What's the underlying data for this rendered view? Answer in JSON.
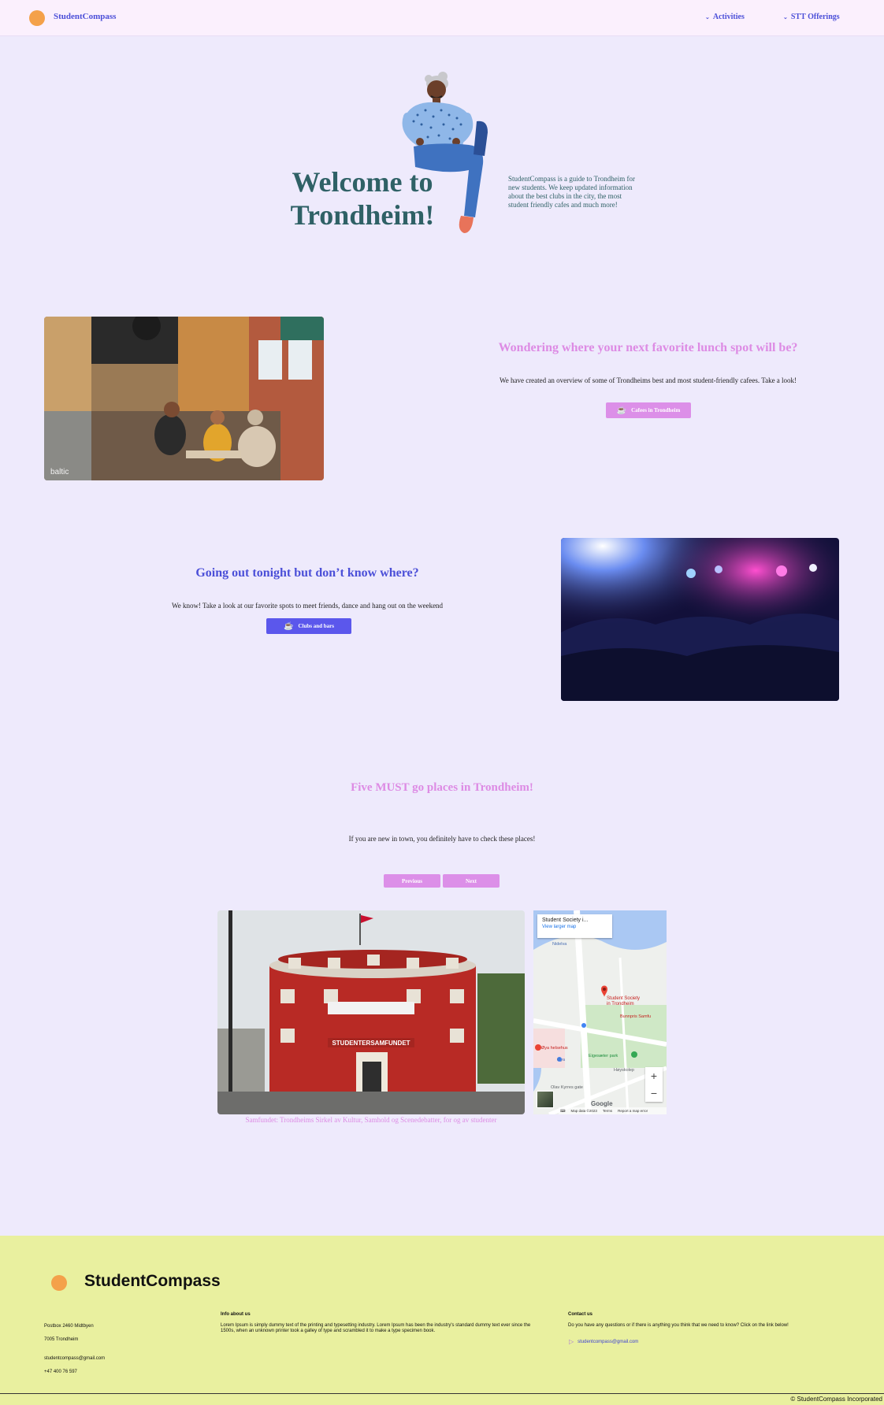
{
  "nav": {
    "brand": "StudentCompass",
    "menu": [
      {
        "label": "Activities"
      },
      {
        "label": "STT Offerings"
      }
    ]
  },
  "hero": {
    "title_line1": "Welcome to",
    "title_line2": "Trondheim!",
    "description": "StudentCompass is a guide to Trondheim for new students. We keep updated information about the best clubs in the city, the most student friendly cafes and much more!"
  },
  "lunch": {
    "title": "Wondering where your next favorite lunch spot will be?",
    "text": "We have created an overview of some of Trondheims best and most student-friendly cafees. Take a look!",
    "button": "Cafees in Trondheim",
    "image_watermark": "baltic"
  },
  "nightlife": {
    "title": "Going out tonight but don’t know where?",
    "text": "We know! Take a look at our favorite spots to meet friends, dance and hang out on the weekend",
    "button": "Clubs and bars"
  },
  "must_go": {
    "title": "Five MUST go places in Trondheim!",
    "text": "If you are new in town, you definitely have to check these places!",
    "prev_button": "Previous",
    "next_button": "Next",
    "caption": "Samfundet: Trondheims Sirkel av Kultur, Samhold og Scenedebatter, for og av studenter",
    "building_sign": "STUDENTERSAMFUNDET"
  },
  "map": {
    "popup_title": "Student Society i...",
    "popup_link": "View larger map",
    "pin_label_line1": "Student Society",
    "pin_label_line2": "in Trondheim",
    "zoom_in": "+",
    "zoom_out": "−",
    "google": "Google",
    "attrib_data": "Map data ©2023",
    "attrib_terms": "Terms",
    "attrib_report": "Report a map error",
    "place_labels": {
      "a": "Bunnpris Samfu",
      "b": "Øya helsehus",
      "c": "Eigesæter park",
      "d": "Høyskolep",
      "e": "Olav Kyrres gate",
      "f": "Nidelva",
      "g": "Øya"
    }
  },
  "footer": {
    "brand": "StudentCompass",
    "address1": "Postbox 2460 Midtbyen",
    "address2": "7005 Trondheim",
    "email": "studentcompass@gmail.com",
    "phone": "+47 400 76 597",
    "about_title": "Info about us",
    "about_text": "Lorem Ipsum is simply dummy text of the printing and typesetting industry. Lorem Ipsum has been the industry's standard dummy text ever since the 1500s, when an unknown printer took a galley of type and scrambled it to make a type specimen book.",
    "contact_title": "Contact us",
    "contact_text": "Do you have any questions or if there is anything you think that we need to know? Click on the link below!",
    "contact_email": "studentcompass@gmail.com",
    "copyright": "© StudentCompass Incorporated"
  },
  "colors": {
    "background": "#eeeafc",
    "nav_bg": "#fbf0fd",
    "primary": "#4b4fd8",
    "pink": "#dd8be4",
    "teal": "#2f6166",
    "footer_bg": "#e9f09f",
    "logo_orange": "#f4a14a"
  }
}
